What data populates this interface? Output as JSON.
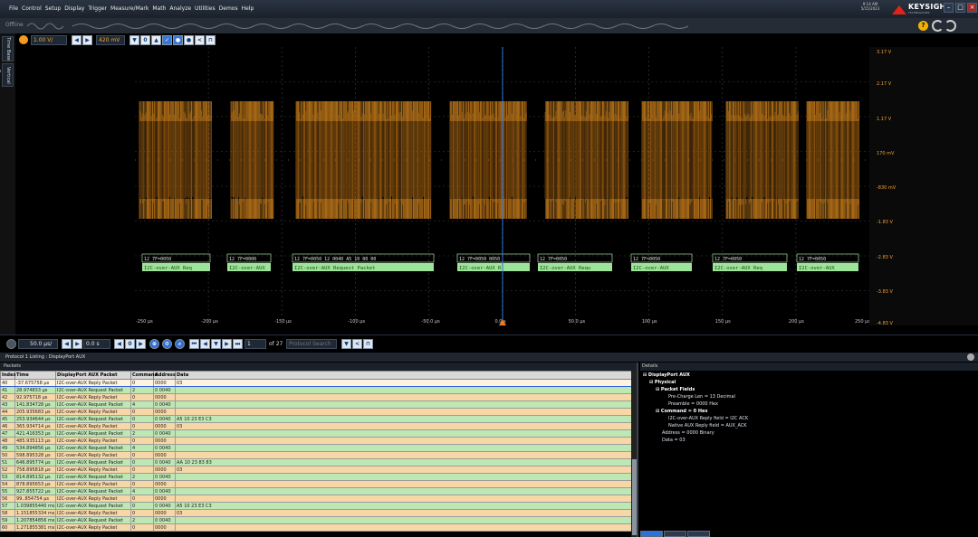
{
  "menu": [
    "File",
    "Control",
    "Setup",
    "Display",
    "Trigger",
    "Measure/Mark",
    "Math",
    "Analyze",
    "Utilities",
    "Demos",
    "Help"
  ],
  "status": {
    "time": "9:14 AM",
    "date": "5/15/2023",
    "brand": "KEYSIGHT",
    "brand_sub": "TECHNOLOGIES",
    "offline": "Offline"
  },
  "left_tabs": {
    "timebase": "Time Base",
    "vertical": "Vertical Base"
  },
  "channel": {
    "scale": "1.00 V/",
    "offset": "420 mV",
    "color": "#f49a1d"
  },
  "voltage_labels": [
    "3.17 V",
    "2.17 V",
    "1.17 V",
    "170 mV",
    "-830 mV",
    "-1.83 V",
    "-2.83 V",
    "-3.83 V",
    "-4.83 V"
  ],
  "time_labels": [
    "-250 µs",
    "-200 µs",
    "-150 µs",
    "-100 µs",
    "-50.0 µs",
    "0.0 s",
    "50.0 µs",
    "100 µs",
    "150 µs",
    "200 µs",
    "250 µs"
  ],
  "decode_labels": {
    "hex": [
      "12 7F=0050",
      "12 7F=0000",
      "12 7F=0050 12 0040 A5 10 00 00",
      "12 7F=0050 0050",
      "12 7F=0050",
      "12 7F=0050",
      "12 7F=0050",
      "12 7F=0050"
    ],
    "text": [
      "I2C-over-AUX Req",
      "I2C-over-AUX",
      "I2C-over-AUX Request Packet",
      "I2C-over-AUX R",
      "I2C-over-AUX Requ",
      "I2C-over-AUX",
      "I2C-over-AUX Req",
      "I2C-over-AUX"
    ]
  },
  "horizontal": {
    "timebase": "50.0 µs/",
    "position": "0.0 s",
    "search_of": "of 27",
    "search_placeholder": "Protocol Search"
  },
  "protocol": {
    "title": "Protocol 1 Listing : DisplayPort AUX",
    "packets_label": "Packets",
    "details_label": "Details"
  },
  "table": {
    "columns": [
      "Index",
      "Time",
      "DisplayPort AUX Packet",
      "Command",
      "Address",
      "Data"
    ],
    "rows": [
      [
        "40",
        "-37.675758 µs",
        "I2C-over-AUX Reply Packet",
        "0",
        "0000",
        "03"
      ],
      [
        "41",
        "28.974833 µs",
        "I2C-over-AUX Request Packet",
        "2",
        "0 0040",
        ""
      ],
      [
        "42",
        "92.975718 µs",
        "I2C-over-AUX Reply Packet",
        "0",
        "0000",
        ""
      ],
      [
        "43",
        "141.834728 µs",
        "I2C-over-AUX Request Packet",
        "4",
        "0 0040",
        ""
      ],
      [
        "44",
        "205.935683 µs",
        "I2C-over-AUX Reply Packet",
        "0",
        "0000",
        ""
      ],
      [
        "45",
        "253.934644 µs",
        "I2C-over-AUX Request Packet",
        "0",
        "0 0040",
        "A5 10 23 E3 C3"
      ],
      [
        "46",
        "365.934714 µs",
        "I2C-over-AUX Reply Packet",
        "0",
        "0000",
        "03"
      ],
      [
        "47",
        "421.416353 µs",
        "I2C-over-AUX Request Packet",
        "2",
        "0 0040",
        ""
      ],
      [
        "48",
        "485.935113 µs",
        "I2C-over-AUX Reply Packet",
        "0",
        "0000",
        ""
      ],
      [
        "49",
        "534.894856 µs",
        "I2C-over-AUX Request Packet",
        "4",
        "0 0040",
        ""
      ],
      [
        "50",
        "598.895328 µs",
        "I2C-over-AUX Reply Packet",
        "0",
        "0000",
        ""
      ],
      [
        "51",
        "646.895774 µs",
        "I2C-over-AUX Request Packet",
        "0",
        "0 0040",
        "AA 10 23 83 83"
      ],
      [
        "52",
        "758.895818 µs",
        "I2C-over-AUX Reply Packet",
        "0",
        "0000",
        "03"
      ],
      [
        "53",
        "814.895132 µs",
        "I2C-over-AUX Request Packet",
        "2",
        "0 0040",
        ""
      ],
      [
        "54",
        "878.895653 µs",
        "I2C-over-AUX Reply Packet",
        "0",
        "0000",
        ""
      ],
      [
        "55",
        "927.855722 µs",
        "I2C-over-AUX Request Packet",
        "4",
        "0 0040",
        ""
      ],
      [
        "56",
        "99..854754 µs",
        "I2C-over-AUX Reply Packet",
        "0",
        "0000",
        ""
      ],
      [
        "57",
        "1.039855440 ms",
        "I2C-over-AUX Request Packet",
        "0",
        "0 0040",
        "A5 10 23 E3 C3"
      ],
      [
        "58",
        "1.151855334 ms",
        "I2C-over-AUX Reply Packet",
        "0",
        "0000",
        "03"
      ],
      [
        "59",
        "1.207854856 ms",
        "I2C-over-AUX Request Packet",
        "2",
        "0 0040",
        ""
      ],
      [
        "60",
        "1.271855381 ms",
        "I2C-over-AUX Reply Packet",
        "0",
        "0000",
        ""
      ]
    ]
  },
  "details": [
    {
      "text": "DisplayPort AUX",
      "bold": true,
      "indent": 0
    },
    {
      "text": "Physical",
      "bold": true,
      "indent": 1
    },
    {
      "text": "Packet Fields",
      "bold": true,
      "indent": 2
    },
    {
      "text": "Pre-Charge Len = 13 Decimal",
      "bold": false,
      "indent": 4
    },
    {
      "text": "Preamble = 0000 Hex",
      "bold": false,
      "indent": 4
    },
    {
      "text": "Command = 0 Hex",
      "bold": true,
      "indent": 2
    },
    {
      "text": "I2C-over-AUX Reply field = I2C ACK",
      "bold": false,
      "indent": 4
    },
    {
      "text": "Native AUX Reply field = AUX_ACK",
      "bold": false,
      "indent": 4
    },
    {
      "text": "Address = 0000 Binary",
      "bold": false,
      "indent": 3
    },
    {
      "text": "Data = 03",
      "bold": false,
      "indent": 3
    }
  ]
}
